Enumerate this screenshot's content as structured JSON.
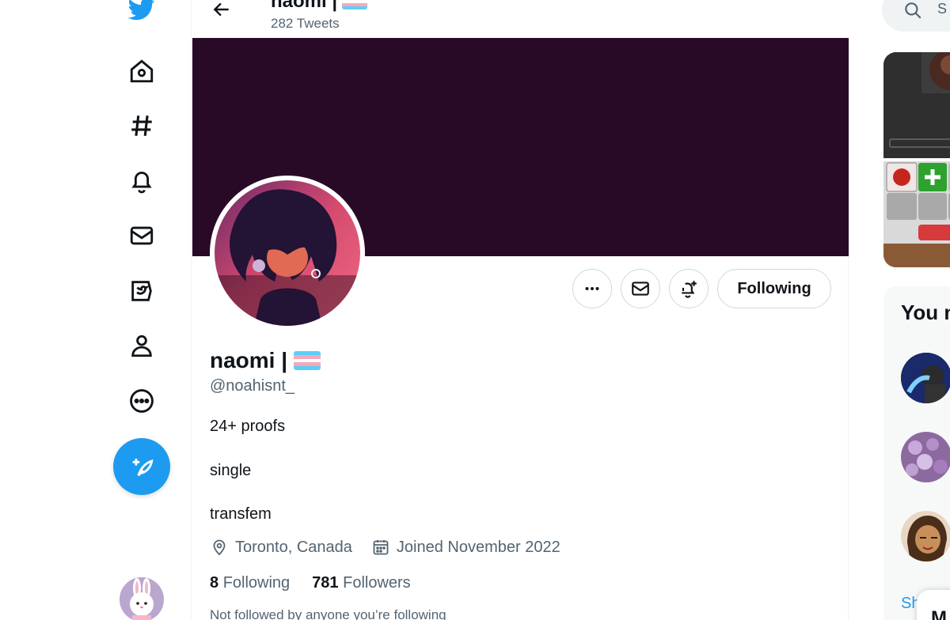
{
  "header": {
    "name": "naomi |",
    "tweet_count": "282 Tweets"
  },
  "profile": {
    "display_name": "naomi |",
    "handle": "@noahisnt_",
    "bio_lines": [
      "24+ proofs",
      "single",
      "transfem"
    ],
    "location": "Toronto, Canada",
    "joined": "Joined November 2022",
    "following_count": "8",
    "following_label": "Following",
    "followers_count": "781",
    "followers_label": "Followers",
    "not_followed_text": "Not followed by anyone you’re following",
    "banner_color": "#280a26"
  },
  "actions": {
    "following_button": "Following"
  },
  "nav": {
    "items": [
      "twitter-logo",
      "home",
      "explore",
      "notifications",
      "messages",
      "lists",
      "profile",
      "more"
    ],
    "accent": "#1d9bf0"
  },
  "right": {
    "search_placeholder": "S",
    "you_might_like": "You m",
    "show_more": "Sh",
    "messages_drawer": "M"
  },
  "flag_colors": [
    "#5bcefa",
    "#f5a9b8",
    "#ffffff",
    "#f5a9b8",
    "#5bcefa"
  ]
}
